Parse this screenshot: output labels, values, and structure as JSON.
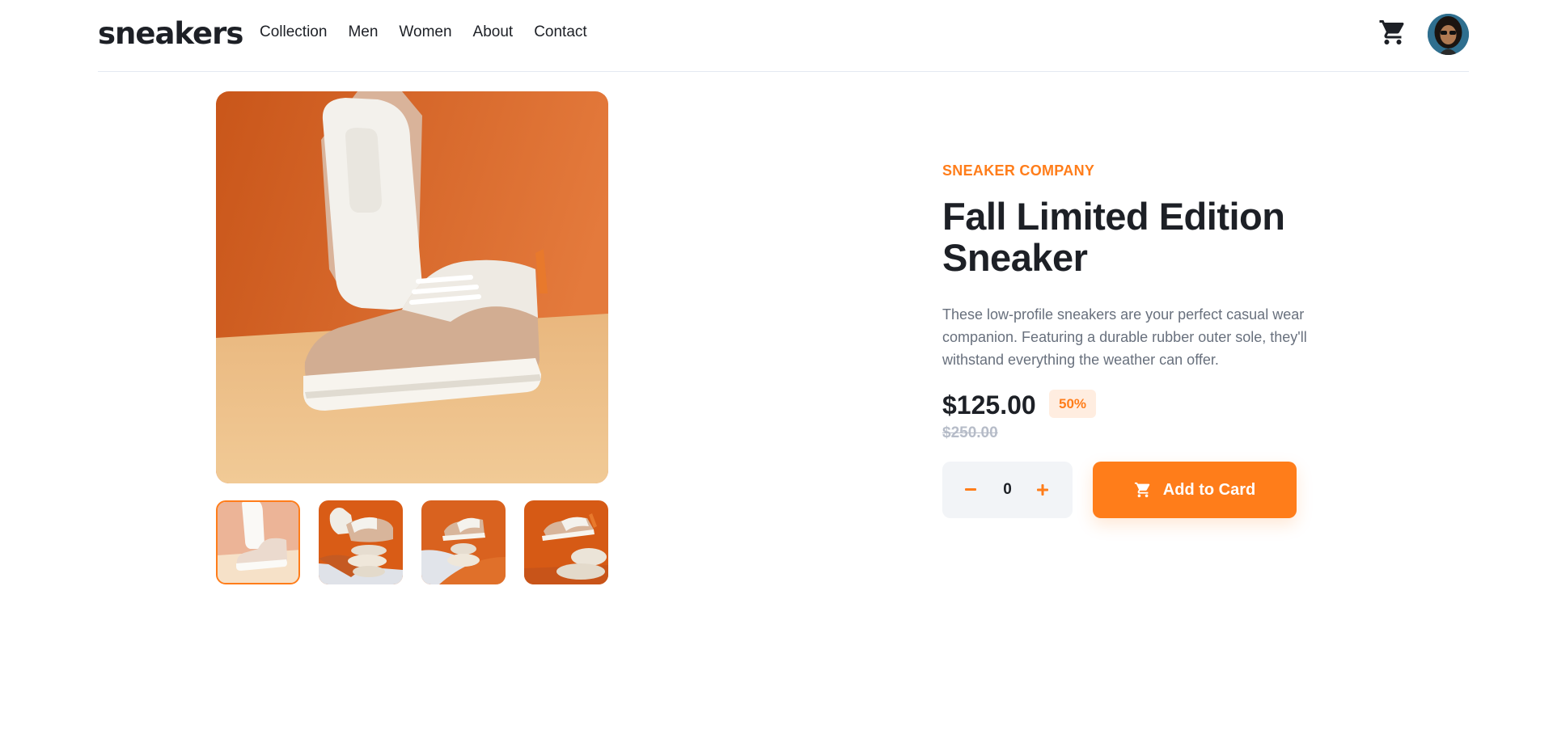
{
  "header": {
    "logo": "sneakers",
    "nav": [
      "Collection",
      "Men",
      "Women",
      "About",
      "Contact"
    ],
    "cart_icon": "cart-icon",
    "avatar_icon": "user-avatar"
  },
  "gallery": {
    "main_image": "sneaker-product-photo-1",
    "thumbnails": [
      "sneaker-thumbnail-1",
      "sneaker-thumbnail-2",
      "sneaker-thumbnail-3",
      "sneaker-thumbnail-4"
    ],
    "active_thumbnail_index": 0
  },
  "product": {
    "company": "SNEAKER COMPANY",
    "title": "Fall Limited Edition Sneaker",
    "description": "These low-profile sneakers are your perfect casual wear companion. Featuring a durable rubber outer sole, they'll withstand everything the weather can offer.",
    "price": "$125.00",
    "discount": "50%",
    "original_price": "$250.00"
  },
  "quantity": {
    "value": "0",
    "minus_icon": "minus-icon",
    "plus_icon": "plus-icon"
  },
  "add_to_cart": {
    "label": "Add to Card",
    "icon": "cart-icon"
  },
  "colors": {
    "accent": "#ff7d1a",
    "accent_pale": "#ffede0",
    "text_dark": "#1d2026",
    "text_gray": "#68707d",
    "text_light": "#b6bcc8",
    "qty_bg": "#f2f4f7"
  }
}
